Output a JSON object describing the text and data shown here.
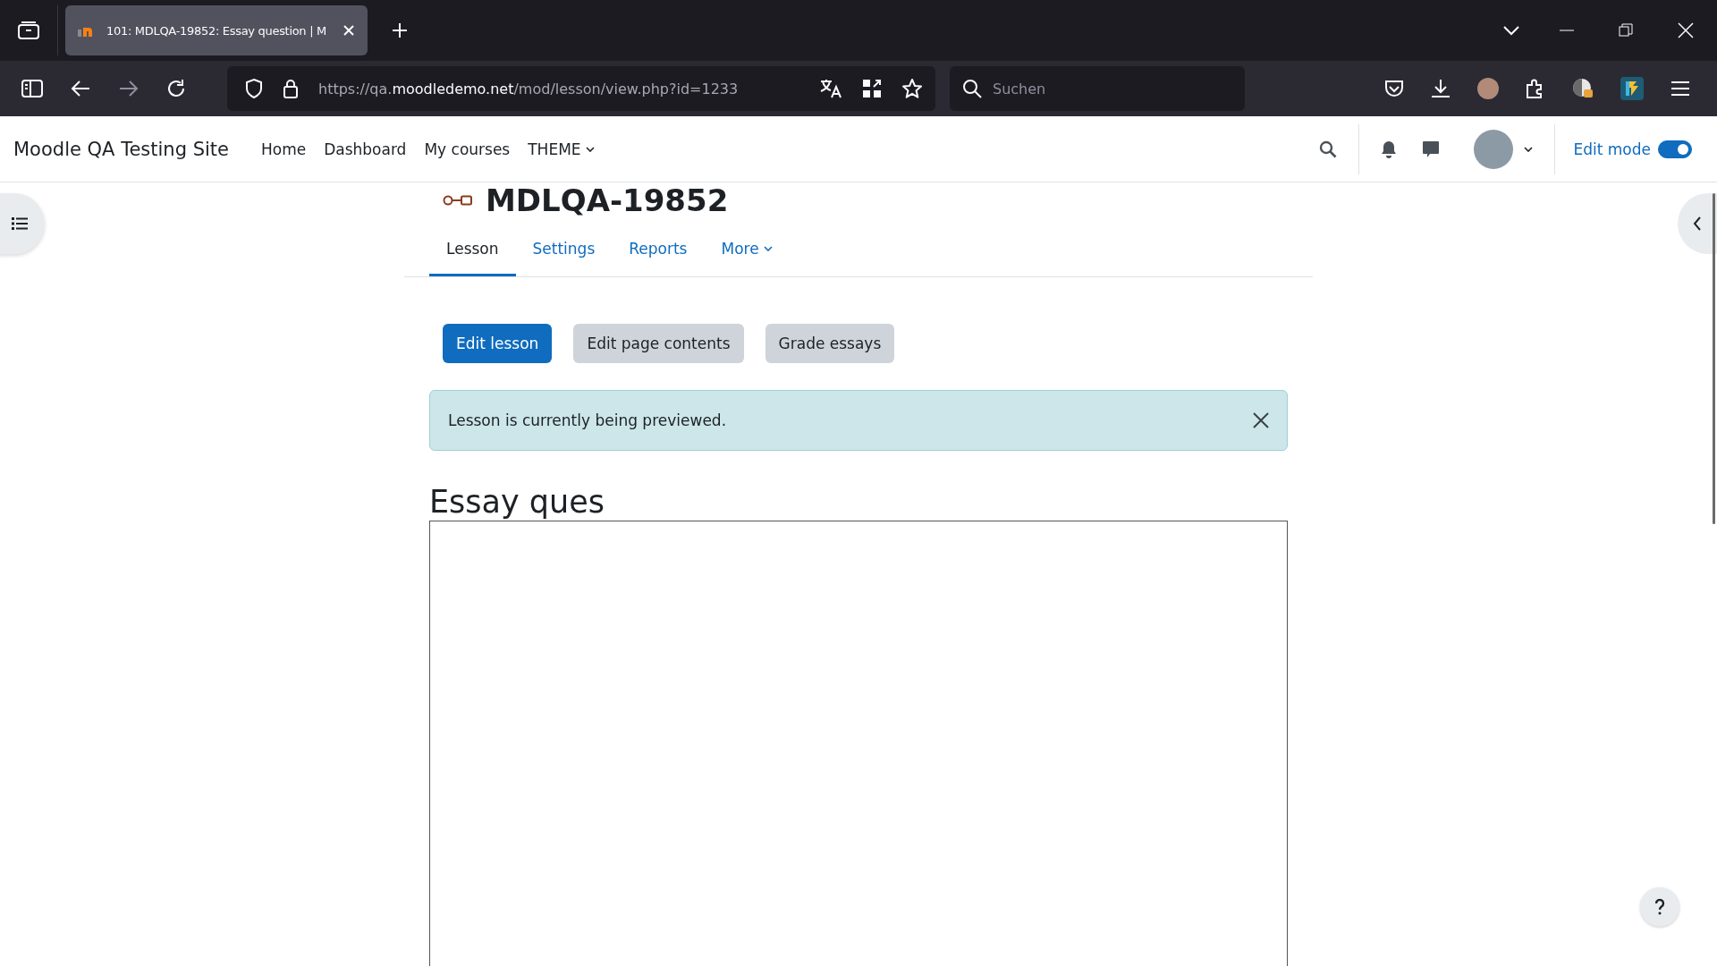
{
  "browser": {
    "tab": {
      "title": "101: MDLQA-19852: Essay question | M"
    },
    "url": {
      "prefix": "https://qa.",
      "domain": "moodledemo.net",
      "path": "/mod/lesson/view.php?id=1233"
    },
    "search": {
      "placeholder": "Suchen"
    }
  },
  "navbar": {
    "site_name": "Moodle QA Testing Site",
    "links": [
      {
        "label": "Home",
        "dropdown": false
      },
      {
        "label": "Dashboard",
        "dropdown": false
      },
      {
        "label": "My courses",
        "dropdown": false
      },
      {
        "label": "THEME",
        "dropdown": true
      }
    ],
    "edit_mode": {
      "label": "Edit mode",
      "on": true
    }
  },
  "page": {
    "title": "MDLQA-19852",
    "tabs": [
      {
        "label": "Lesson",
        "selected": true,
        "dropdown": false
      },
      {
        "label": "Settings",
        "selected": false,
        "dropdown": false
      },
      {
        "label": "Reports",
        "selected": false,
        "dropdown": false
      },
      {
        "label": "More",
        "selected": false,
        "dropdown": true
      }
    ],
    "buttons": [
      {
        "label": "Edit lesson",
        "kind": "primary"
      },
      {
        "label": "Edit page contents",
        "kind": "secondary"
      },
      {
        "label": "Grade essays",
        "kind": "secondary"
      }
    ],
    "alert": {
      "message": "Lesson is currently being previewed."
    },
    "question_title": "Essay ques"
  }
}
